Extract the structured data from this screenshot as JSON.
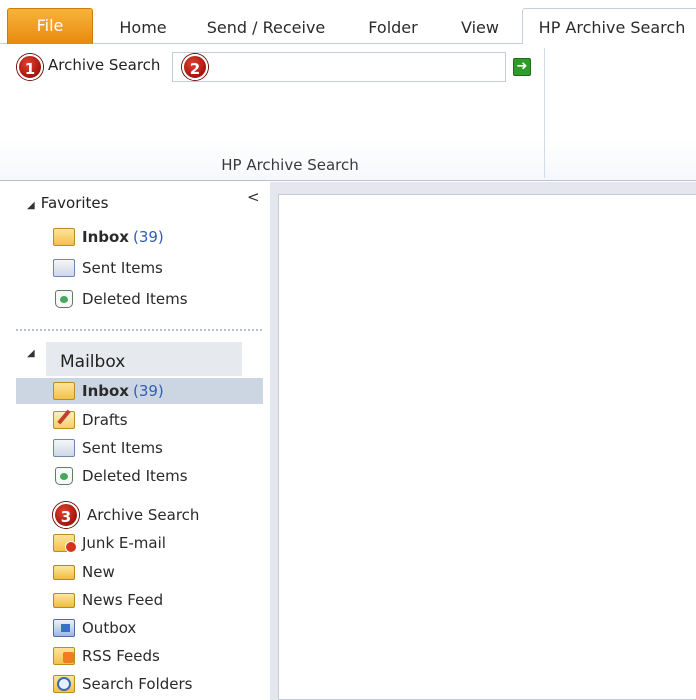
{
  "tabs": {
    "file": "File",
    "home": "Home",
    "send_receive": "Send / Receive",
    "folder": "Folder",
    "view": "View",
    "hp_archive_search": "HP Archive Search"
  },
  "ribbon": {
    "archive_search_label": "Archive Search",
    "search_value": "",
    "go_icon": "go-arrow-icon",
    "group_label": "HP Archive Search"
  },
  "badges": {
    "one": "1",
    "two": "2",
    "three": "3"
  },
  "nav": {
    "collapse_glyph": "<",
    "favorites": {
      "heading": "Favorites",
      "items": [
        {
          "label": "Inbox",
          "count": "(39)",
          "icon": "inbox-icon"
        },
        {
          "label": "Sent Items",
          "icon": "sent-items-icon"
        },
        {
          "label": "Deleted Items",
          "icon": "deleted-items-icon"
        }
      ]
    },
    "mailbox": {
      "heading": "Mailbox",
      "items": [
        {
          "label": "Inbox",
          "count": "(39)",
          "icon": "inbox-icon",
          "selected": true
        },
        {
          "label": "Drafts",
          "icon": "drafts-icon"
        },
        {
          "label": "Sent Items",
          "icon": "sent-items-icon"
        },
        {
          "label": "Deleted Items",
          "icon": "deleted-items-icon"
        },
        {
          "label": "Archive Search"
        },
        {
          "label": "Junk E-mail",
          "icon": "junk-email-icon"
        },
        {
          "label": "New",
          "icon": "folder-icon"
        },
        {
          "label": "News Feed",
          "icon": "folder-icon"
        },
        {
          "label": "Outbox",
          "icon": "outbox-icon"
        },
        {
          "label": "RSS Feeds",
          "icon": "rss-feeds-icon"
        },
        {
          "label": "Search Folders",
          "icon": "search-folders-icon"
        }
      ]
    }
  },
  "colors": {
    "file_tab": "#e9890f",
    "badge": "#c0241a",
    "selected_row": "#ccd6e2",
    "count_text": "#2f5fb3"
  }
}
